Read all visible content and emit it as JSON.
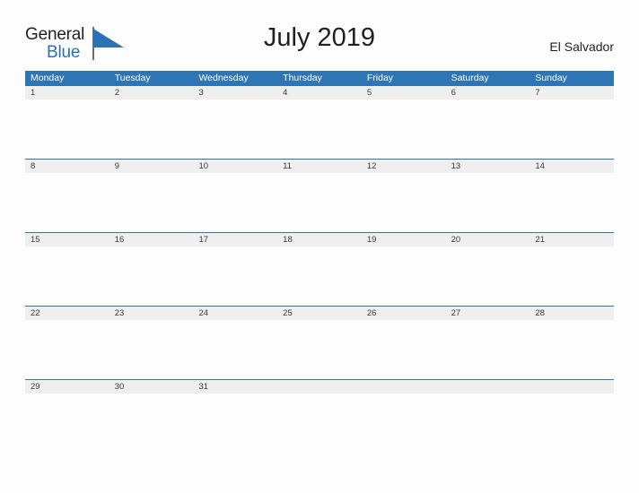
{
  "brand": {
    "name_part1": "General",
    "name_part2": "Blue",
    "flag_icon": "flag-triangle-icon",
    "color_dark": "#231f20",
    "color_blue": "#2a72b5"
  },
  "header": {
    "title": "July 2019",
    "country": "El Salvador"
  },
  "theme": {
    "header_blue": "#2e75b6",
    "date_band_gray": "#efefef",
    "page_background": "#fdfdfd",
    "date_text": "#3a3a3a"
  },
  "calendar": {
    "weekdays": [
      "Monday",
      "Tuesday",
      "Wednesday",
      "Thursday",
      "Friday",
      "Saturday",
      "Sunday"
    ],
    "weeks": [
      [
        "1",
        "2",
        "3",
        "4",
        "5",
        "6",
        "7"
      ],
      [
        "8",
        "9",
        "10",
        "11",
        "12",
        "13",
        "14"
      ],
      [
        "15",
        "16",
        "17",
        "18",
        "19",
        "20",
        "21"
      ],
      [
        "22",
        "23",
        "24",
        "25",
        "26",
        "27",
        "28"
      ],
      [
        "29",
        "30",
        "31",
        "",
        "",
        "",
        ""
      ]
    ]
  }
}
